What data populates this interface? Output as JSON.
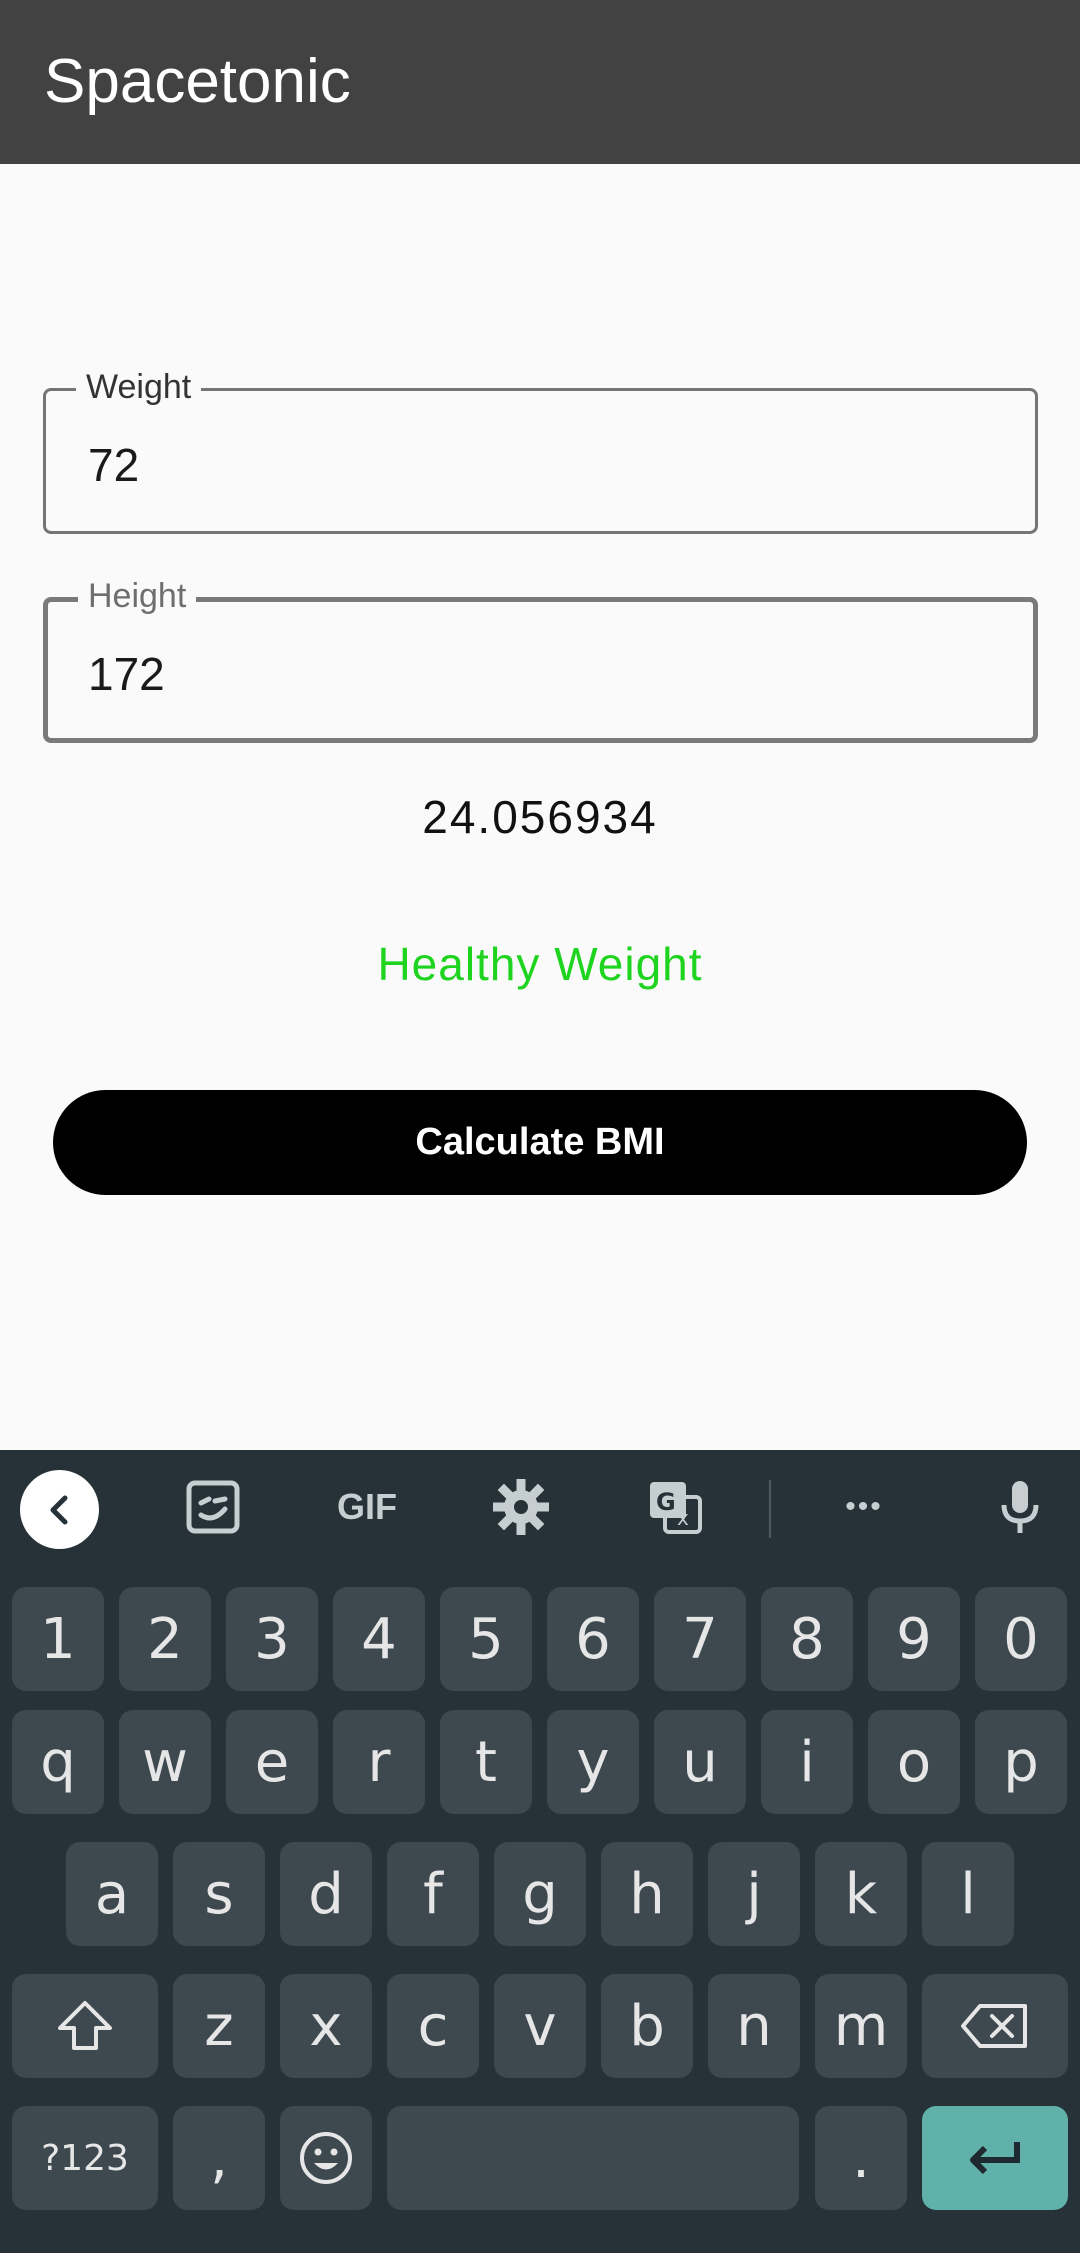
{
  "app_bar": {
    "title": "Spacetonic"
  },
  "form": {
    "weight": {
      "label": "Weight",
      "value": "72"
    },
    "height": {
      "label": "Height",
      "value": "172"
    }
  },
  "result": {
    "bmi": "24.056934",
    "status": "Healthy Weight",
    "status_color": "#1ed41e"
  },
  "calculate_button": {
    "label": "Calculate BMI"
  },
  "keyboard": {
    "toolbar_icons": [
      "back-arrow-icon",
      "sticker-icon",
      "gif-icon",
      "settings-icon",
      "translate-icon",
      "more-icon",
      "microphone-icon"
    ],
    "gif_label": "GIF",
    "more_label": "•••",
    "row1": [
      "1",
      "2",
      "3",
      "4",
      "5",
      "6",
      "7",
      "8",
      "9",
      "0"
    ],
    "row2": [
      "q",
      "w",
      "e",
      "r",
      "t",
      "y",
      "u",
      "i",
      "o",
      "p"
    ],
    "row3": [
      "a",
      "s",
      "d",
      "f",
      "g",
      "h",
      "j",
      "k",
      "l"
    ],
    "row4": [
      "z",
      "x",
      "c",
      "v",
      "b",
      "n",
      "m"
    ],
    "symbols_key": "?123",
    "comma_key": ",",
    "period_key": ".",
    "enter_color": "#5fb1aa"
  }
}
